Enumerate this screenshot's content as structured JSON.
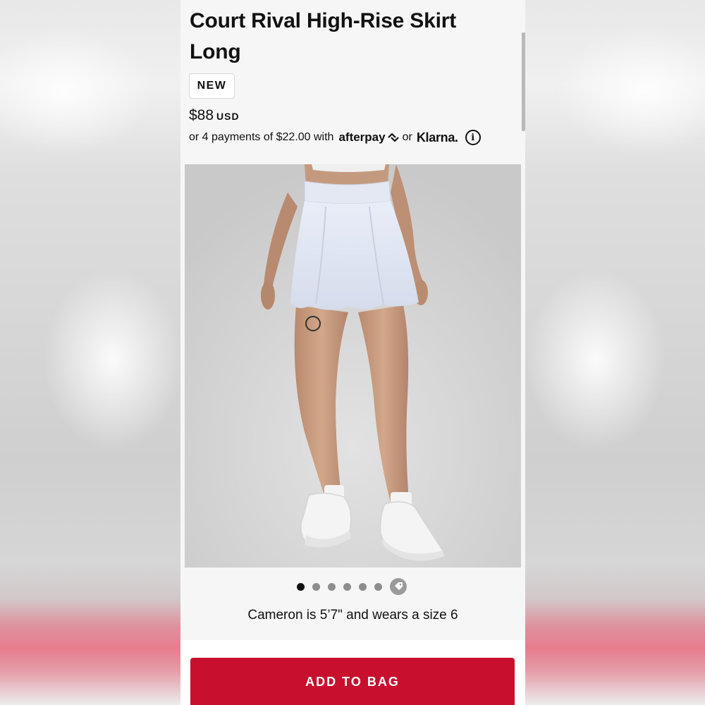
{
  "product": {
    "title": "Court Rival High-Rise Skirt Long",
    "badge": "NEW",
    "price": "$88",
    "currency": "USD",
    "payments_text": "or 4 payments of $22.00 with",
    "afterpay_label": "afterpay",
    "or_text": "or",
    "klarna_label": "Klarna.",
    "info_glyph": "i",
    "image_alt": "Model wearing a light blue high-rise tennis skirt with white sneakers"
  },
  "gallery": {
    "image_count": 6,
    "active_index": 0
  },
  "model_caption": "Cameron is 5’7\" and wears a size 6",
  "cta": {
    "add_to_bag_label": "ADD TO BAG",
    "color": "#c8102e"
  }
}
